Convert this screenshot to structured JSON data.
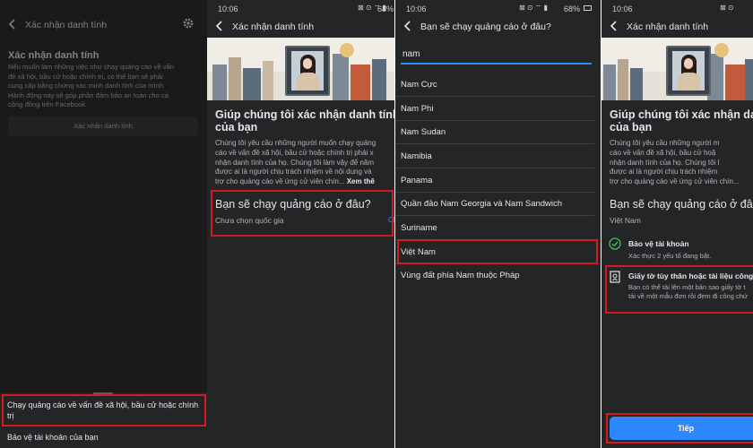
{
  "status": {
    "time": "10:06",
    "battery": "68%"
  },
  "panel1": {
    "app_title": "Xác nhận danh tính",
    "heading": "Xác nhận danh tính",
    "description_lines": [
      "Nếu muốn làm những việc như chạy quảng cáo về vấn",
      "đề xã hội, bầu cử hoặc chính trị, có thể bạn sẽ phải",
      "cung cấp bằng chứng xác minh danh tính của mình.",
      "Hành động này sẽ góp phần đảm bảo an toàn cho cả",
      "cộng đồng trên Facebook."
    ],
    "verify_button": "Xác nhận danh tính",
    "sheet_item_1_lines": [
      "Chạy quảng cáo về vấn đề xã hội, bầu cử hoặc chính",
      "trị"
    ],
    "sheet_item_2": "Bảo vệ tài khoản của bạn"
  },
  "panel2": {
    "app_title": "Xác nhận danh tính",
    "heading_lines": [
      "Giúp chúng tôi xác nhận danh tính",
      "của bạn"
    ],
    "body_lines": [
      "Chúng tôi yêu cầu những người muốn chạy quảng",
      "cáo về vấn đề xã hội, bầu cử hoặc chính trị phải x",
      "nhận danh tính của họ. Chúng tôi làm vậy để nâm",
      "được ai là người chịu trách nhiệm về nội dung và",
      "trợ cho quảng cáo về ứng cử viên chín..."
    ],
    "see_more": "Xem thê",
    "question": "Bạn sẽ chạy quảng cáo ở đâu?",
    "placeholder": "Chưa chọn quốc gia",
    "edge_link": "Ch"
  },
  "panel3": {
    "app_title": "Bạn sẽ chạy quảng cáo ở đâu?",
    "search_value": "nam",
    "countries": [
      "Nam Cực",
      "Nam Phi",
      "Nam Sudan",
      "Namibia",
      "Panama",
      "Quần đảo Nam Georgia và Nam Sandwich",
      "Suriname",
      "Việt Nam",
      "Vùng đất phía Nam thuộc Pháp"
    ]
  },
  "panel4": {
    "app_title": "Xác nhận danh tính",
    "heading_lines": [
      "Giúp chúng tôi xác nhận danh",
      "của bạn"
    ],
    "body_lines": [
      "Chúng tôi yêu cầu những người m",
      "cáo về vấn đề xã hội, bầu cử hoặ",
      "nhận danh tính của họ. Chúng tôi l",
      "được ai là người chịu trách nhiệm",
      "trợ cho quảng cáo về ứng cử viên chín..."
    ],
    "question": "Bạn sẽ chạy quảng cáo ở đâ",
    "selected_country": "Việt Nam",
    "step1_title": "Bảo vệ tài khoản",
    "step1_desc": "Xác thực 2 yếu tố đang bật.",
    "step2_title": "Giấy tờ tùy thân hoặc tài liệu công",
    "step2_desc_lines": [
      "Bạn có thể tải lên một bản sao giấy tờ t",
      "tải về một mẫu đơn rồi đem đi công chứ"
    ],
    "next_button": "Tiếp"
  },
  "colors": {
    "background": "#242526",
    "accent": "#2d88ff",
    "highlight": "#d71920",
    "success": "#45bd62"
  }
}
